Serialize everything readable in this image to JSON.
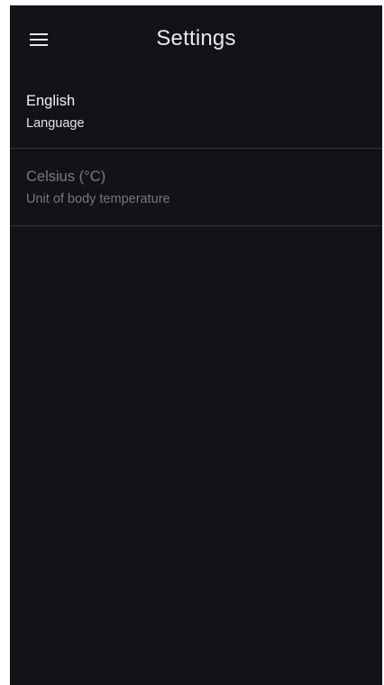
{
  "app_bar": {
    "menu_icon": "hamburger-menu-icon",
    "title": "Settings"
  },
  "settings": {
    "items": [
      {
        "value": "English",
        "label": "Language",
        "enabled": true
      },
      {
        "value": "Celsius (°C)",
        "label": "Unit of body temperature",
        "enabled": false
      }
    ]
  },
  "colors": {
    "background": "#131217",
    "divider": "#34333a",
    "text_primary": "#f2f2f4",
    "text_disabled": "#7b7a81"
  }
}
